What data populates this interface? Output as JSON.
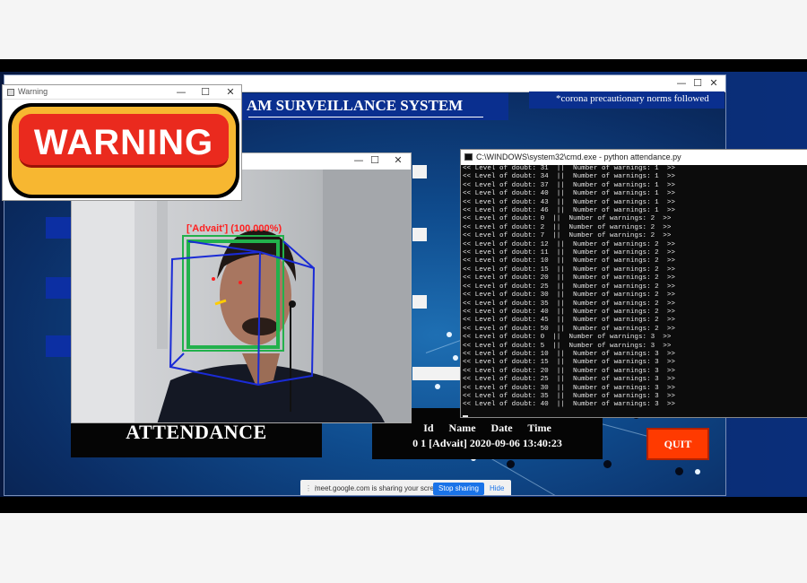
{
  "app": {
    "title": "AM SURVEILLANCE SYSTEM",
    "notice": "*corona precautionary norms followed",
    "attendance_label": "ATTENDANCE",
    "quit_label": "QUIT"
  },
  "attendance_record": {
    "headers": [
      "Id",
      "Name",
      "Date",
      "Time"
    ],
    "row": "0  1  [Advait]  2020-09-06  13:40:23"
  },
  "warning_window": {
    "title": "Warning",
    "sign_text": "WARNING"
  },
  "camera": {
    "detection_label": "['Advait'] (100.000%)"
  },
  "cmd_window": {
    "title": "C:\\WINDOWS\\system32\\cmd.exe - python  attendance.py",
    "lines": [
      "<< Level of doubt: 31  ||  Number of warnings: 1  >>",
      "<< Level of doubt: 34  ||  Number of warnings: 1  >>",
      "<< Level of doubt: 37  ||  Number of warnings: 1  >>",
      "<< Level of doubt: 40  ||  Number of warnings: 1  >>",
      "<< Level of doubt: 43  ||  Number of warnings: 1  >>",
      "<< Level of doubt: 46  ||  Number of warnings: 1  >>",
      "<< Level of doubt: 0  ||  Number of warnings: 2  >>",
      "<< Level of doubt: 2  ||  Number of warnings: 2  >>",
      "<< Level of doubt: 7  ||  Number of warnings: 2  >>",
      "<< Level of doubt: 12  ||  Number of warnings: 2  >>",
      "<< Level of doubt: 11  ||  Number of warnings: 2  >>",
      "<< Level of doubt: 10  ||  Number of warnings: 2  >>",
      "<< Level of doubt: 15  ||  Number of warnings: 2  >>",
      "<< Level of doubt: 20  ||  Number of warnings: 2  >>",
      "<< Level of doubt: 25  ||  Number of warnings: 2  >>",
      "<< Level of doubt: 30  ||  Number of warnings: 2  >>",
      "<< Level of doubt: 35  ||  Number of warnings: 2  >>",
      "<< Level of doubt: 40  ||  Number of warnings: 2  >>",
      "<< Level of doubt: 45  ||  Number of warnings: 2  >>",
      "<< Level of doubt: 50  ||  Number of warnings: 2  >>",
      "<< Level of doubt: 0  ||  Number of warnings: 3  >>",
      "<< Level of doubt: 5  ||  Number of warnings: 3  >>",
      "<< Level of doubt: 10  ||  Number of warnings: 3  >>",
      "<< Level of doubt: 15  ||  Number of warnings: 3  >>",
      "<< Level of doubt: 20  ||  Number of warnings: 3  >>",
      "<< Level of doubt: 25  ||  Number of warnings: 3  >>",
      "<< Level of doubt: 30  ||  Number of warnings: 3  >>",
      "<< Level of doubt: 35  ||  Number of warnings: 3  >>",
      "<< Level of doubt: 40  ||  Number of warnings: 3  >>"
    ]
  },
  "share_bar": {
    "text": "meet.google.com is sharing your screen.",
    "stop_label": "Stop sharing",
    "hide_label": "Hide"
  },
  "window_controls": {
    "minimize": "—",
    "maximize": "☐",
    "close": "✕"
  },
  "colors": {
    "title_bar_blue": "#0a2f8f",
    "quit_red": "#ff3a00",
    "warning_red": "#ea2a1e",
    "warning_yellow": "#f7b731",
    "detection_green": "#22b14c",
    "box_blue": "#1a2bd6",
    "detection_label_red": "#ff2020"
  },
  "icons": [
    "minimize-icon",
    "maximize-icon",
    "close-icon",
    "cmd-icon",
    "warning-app-icon",
    "drag-grip-icon"
  ]
}
